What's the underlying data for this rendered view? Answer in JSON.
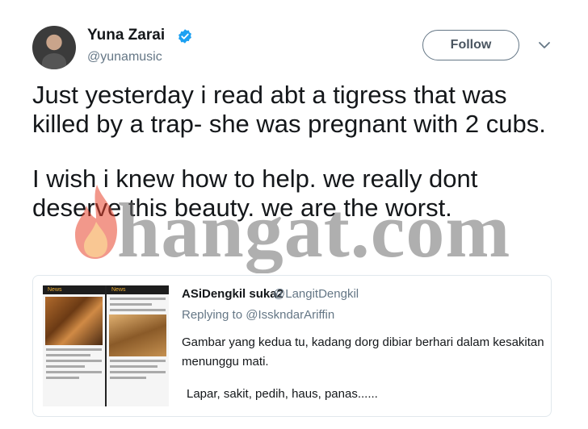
{
  "author": {
    "name": "Yuna Zarai",
    "handle": "@yunamusic",
    "verified": true
  },
  "follow_label": "Follow",
  "tweet": {
    "paragraph1": "Just yesterday i read abt a tigress that was killed by a trap- she was pregnant with 2 cubs.",
    "paragraph2": "I wish i knew how to help. we really dont deserve this beauty. we are the worst."
  },
  "watermark": "hangat.com",
  "quoted": {
    "name": "ASiDengkil suka2",
    "handle": "@LangitDengkil",
    "reply_prefix": "Replying to",
    "reply_to": "@IsskndarAriffin",
    "text1": "Gambar yang kedua tu, kadang dorg dibiar berhari dalam kesakitan menunggu mati.",
    "text2": "Lapar, sakit, pedih, haus, panas......",
    "thumb_bar_label": "News"
  },
  "colors": {
    "verified": "#1da1f2",
    "secondary_text": "#657786",
    "reply_link": "#657786",
    "flame": "#e8442e"
  }
}
